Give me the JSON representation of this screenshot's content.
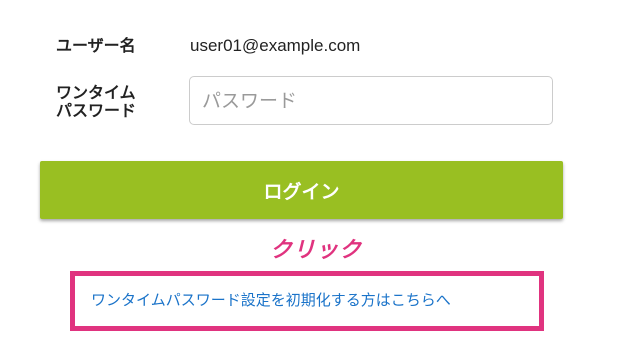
{
  "form": {
    "username_label": "ユーザー名",
    "username_value": "user01@example.com",
    "otp_label": "ワンタイム\nパスワード",
    "otp_placeholder": "パスワード",
    "otp_value": ""
  },
  "login_button": {
    "label": "ログイン"
  },
  "annotation": {
    "text": "クリック",
    "color": "#e0337f"
  },
  "reset_link": {
    "text": "ワンタイムパスワード設定を初期化する方はこちらへ"
  },
  "colors": {
    "button_background": "#99bf22",
    "link": "#1a73c9",
    "highlight": "#e0337f"
  }
}
